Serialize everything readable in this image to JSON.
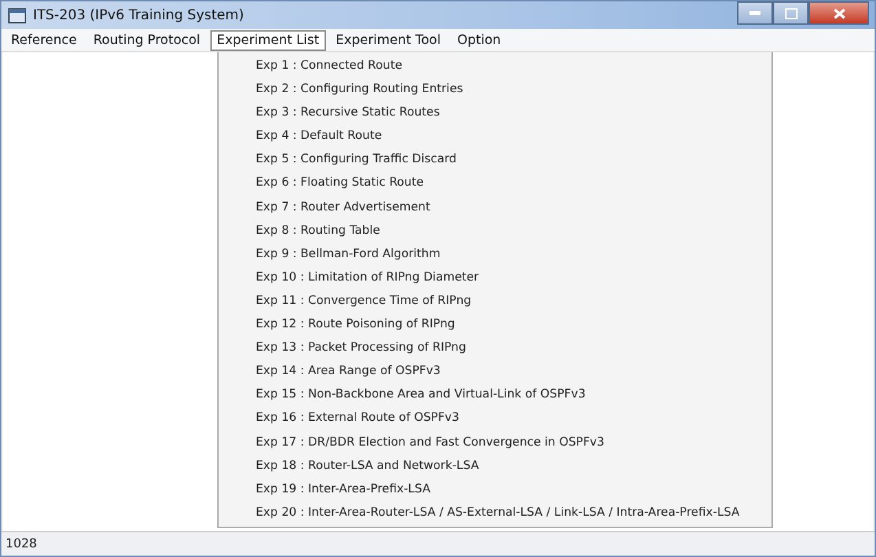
{
  "window": {
    "title": "ITS-203 (IPv6 Training System)"
  },
  "menu": [
    {
      "label": "Reference",
      "selected": false
    },
    {
      "label": "Routing Protocol",
      "selected": false
    },
    {
      "label": "Experiment List",
      "selected": true
    },
    {
      "label": "Experiment Tool",
      "selected": false
    },
    {
      "label": "Option",
      "selected": false
    }
  ],
  "dropdown": {
    "items": [
      "Exp 1 : Connected Route",
      "Exp 2 : Configuring Routing Entries",
      "Exp 3 : Recursive Static Routes",
      "Exp 4 : Default Route",
      "Exp 5 : Configuring Traffic Discard",
      "Exp 6 : Floating Static Route",
      "Exp 7 : Router Advertisement",
      "Exp 8 : Routing Table",
      "Exp 9 : Bellman-Ford Algorithm",
      "Exp 10 : Limitation of RIPng Diameter",
      "Exp 11 : Convergence Time of RIPng",
      "Exp 12 : Route Poisoning of RIPng",
      "Exp 13 : Packet Processing of RIPng",
      "Exp 14 : Area Range of OSPFv3",
      "Exp 15 : Non-Backbone Area and Virtual-Link of OSPFv3",
      "Exp 16 : External Route of OSPFv3",
      "Exp 17 : DR/BDR Election and Fast Convergence in OSPFv3",
      "Exp 18 : Router-LSA and Network-LSA",
      "Exp 19 : Inter-Area-Prefix-LSA",
      "Exp 20 : Inter-Area-Router-LSA / AS-External-LSA / Link-LSA / Intra-Area-Prefix-LSA"
    ]
  },
  "status_bar": {
    "text": "1028"
  }
}
